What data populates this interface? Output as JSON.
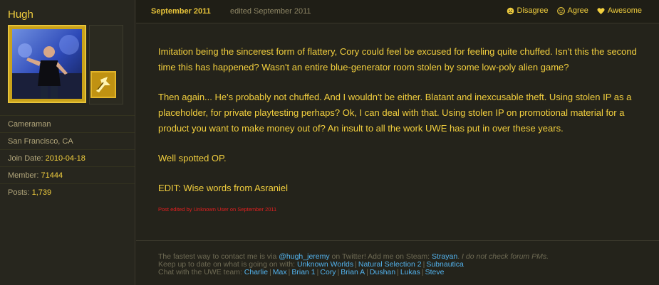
{
  "author": {
    "name": "Hugh",
    "title": "Cameraman",
    "location": "San Francisco, CA",
    "join_label": "Join Date: ",
    "join_value": "2010-04-18",
    "member_label": "Member: ",
    "member_value": "71444",
    "posts_label": "Posts: ",
    "posts_value": "1,739"
  },
  "post": {
    "date": "September 2011",
    "edited": "edited September 2011",
    "reactions": {
      "disagree": "Disagree",
      "agree": "Agree",
      "awesome": "Awesome"
    },
    "paragraphs": [
      "Imitation being the sincerest form of flattery, Cory could feel be excused for feeling quite chuffed. Isn't this the second time this has happened? Wasn't an entire blue-generator room stolen by some low-poly alien game?",
      "Then again... He's probably not chuffed. And I wouldn't be either. Blatant and inexcusable theft. Using stolen IP as a placeholder, for private playtesting perhaps? Ok, I can deal with that. Using stolen IP on promotional material for a product you want to make money out of? An insult to all the work UWE has put in over these years.",
      "Well spotted OP.",
      "EDIT: Wise words from Asraniel"
    ],
    "edit_note": "Post edited by Unknown User on September 2011"
  },
  "signature": {
    "line1_prefix": "The fastest way to contact me is via ",
    "twitter": "@hugh_jeremy",
    "line1_mid": " on Twitter! Add me on Steam: ",
    "steam": "Strayan",
    "line1_dot": ". ",
    "line1_em": "I do not check forum PMs.",
    "line2_prefix": "Keep up to date on what is going on with: ",
    "line2_links": [
      "Unknown Worlds",
      "Natural Selection 2",
      "Subnautica"
    ],
    "line3_prefix": "Chat with the UWE team: ",
    "line3_links": [
      "Charlie",
      "Max",
      "Brian 1",
      "Cory",
      "Brian A",
      "Dushan",
      "Lukas",
      "Steve"
    ]
  },
  "colors": {
    "accent": "#f2cf3e",
    "link": "#53b3ee",
    "edit_note": "#e02020"
  },
  "icons": {
    "disagree": "frown-face-icon",
    "agree": "neutral-face-icon",
    "awesome": "heart-icon",
    "rank": "rank-badge-icon"
  }
}
